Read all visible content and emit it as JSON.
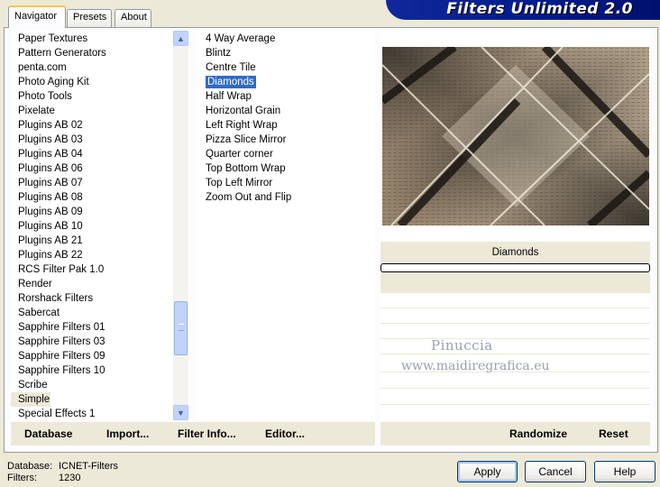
{
  "tabs": [
    "Navigator",
    "Presets",
    "About"
  ],
  "banner_title": "Filters Unlimited 2.0",
  "categories": [
    "Paper Textures",
    "Pattern Generators",
    "penta.com",
    "Photo Aging Kit",
    "Photo Tools",
    "Pixelate",
    "Plugins AB 02",
    "Plugins AB 03",
    "Plugins AB 04",
    "Plugins AB 06",
    "Plugins AB 07",
    "Plugins AB 08",
    "Plugins AB 09",
    "Plugins AB 10",
    "Plugins AB 21",
    "Plugins AB 22",
    "RCS Filter Pak 1.0",
    "Render",
    "Rorshack Filters",
    "Sabercat",
    "Sapphire Filters 01",
    "Sapphire Filters 03",
    "Sapphire Filters 09",
    "Sapphire Filters 10",
    "Scribe",
    "Simple",
    "Special Effects 1"
  ],
  "selected_category": "Simple",
  "filters": [
    "4 Way Average",
    "Blintz",
    "Centre Tile",
    "Diamonds",
    "Half Wrap",
    "Horizontal Grain",
    "Left Right Wrap",
    "Pizza Slice Mirror",
    "Quarter corner",
    "Top Bottom Wrap",
    "Top Left Mirror",
    "Zoom Out and Flip"
  ],
  "selected_filter": "Diamonds",
  "left_buttons": {
    "database": "Database",
    "import": "Import...",
    "filter_info": "Filter Info...",
    "editor": "Editor..."
  },
  "right_buttons": {
    "randomize": "Randomize",
    "reset": "Reset"
  },
  "preview_filter_name": "Diamonds",
  "watermark": {
    "line1": "Pinuccia",
    "line2": "www.maidiregrafica.eu"
  },
  "footer": {
    "database_label": "Database:",
    "database_value": "ICNET-Filters",
    "filters_label": "Filters:",
    "filters_value": "1230"
  },
  "dialog_buttons": {
    "apply": "Apply",
    "cancel": "Cancel",
    "help": "Help"
  },
  "colors": {
    "banner": "#10289a",
    "selection": "#316ac5",
    "window_bg": "#ece9d8"
  }
}
